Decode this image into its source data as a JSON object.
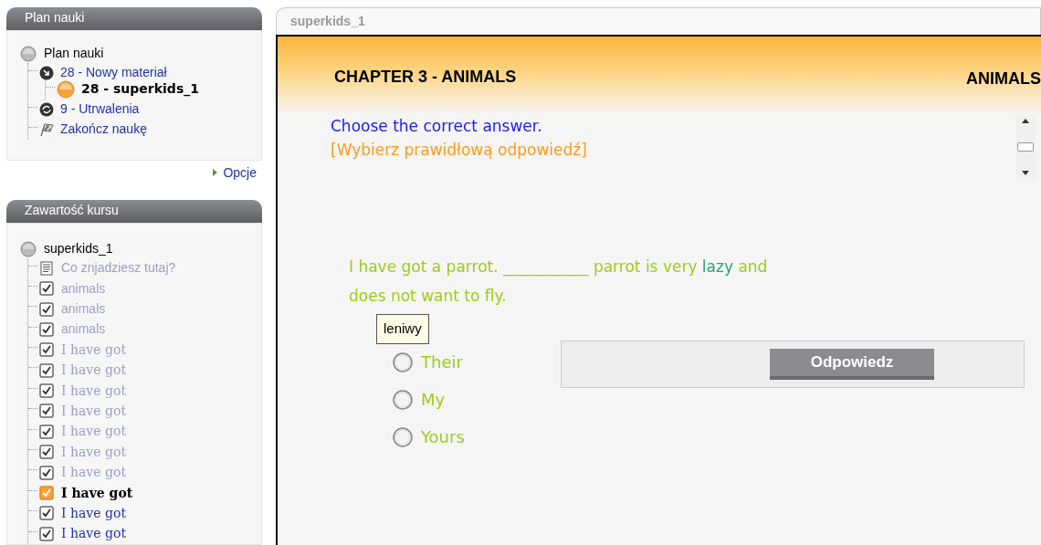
{
  "plan_panel": {
    "title": "Plan nauki",
    "root": {
      "label": "Plan nauki",
      "children": [
        {
          "kind": "arrow",
          "label": "28 - Nowy materiał",
          "selected": false,
          "children": [
            {
              "kind": "current",
              "label": "28 - superkids_1",
              "selected": true
            }
          ]
        },
        {
          "kind": "repeat",
          "label": "9 - Utrwalenia",
          "selected": false
        },
        {
          "kind": "finish",
          "label": "Zakończ naukę",
          "selected": false
        }
      ]
    },
    "options_link": "Opcje"
  },
  "course_panel": {
    "title": "Zawartość kursu",
    "root": "superkids_1",
    "items": [
      {
        "kind": "page",
        "label": "Co znjadziesz tutaj?",
        "visited": true,
        "selected": false
      },
      {
        "kind": "check",
        "label": "animals",
        "visited": true,
        "selected": false
      },
      {
        "kind": "check",
        "label": "animals",
        "visited": true,
        "selected": false
      },
      {
        "kind": "check",
        "label": "animals",
        "visited": true,
        "selected": false
      },
      {
        "kind": "check",
        "label": "I have got",
        "visited": true,
        "selected": false
      },
      {
        "kind": "check",
        "label": "I have got",
        "visited": true,
        "selected": false
      },
      {
        "kind": "check",
        "label": "I have got",
        "visited": true,
        "selected": false
      },
      {
        "kind": "check",
        "label": "I have got",
        "visited": true,
        "selected": false
      },
      {
        "kind": "check",
        "label": "I have got",
        "visited": true,
        "selected": false
      },
      {
        "kind": "check",
        "label": "I have got",
        "visited": true,
        "selected": false
      },
      {
        "kind": "check",
        "label": "I have got",
        "visited": true,
        "selected": false
      },
      {
        "kind": "check",
        "label": "I have got",
        "visited": false,
        "selected": true
      },
      {
        "kind": "check",
        "label": "I have got",
        "visited": false,
        "selected": false
      },
      {
        "kind": "check",
        "label": "I have got",
        "visited": false,
        "selected": false
      }
    ]
  },
  "lesson": {
    "tab": "superkids_1",
    "chapter": "CHAPTER 3 - ANIMALS",
    "chapter_right": "ANIMALS",
    "instruction": "Choose the correct answer.",
    "instruction_translation": "[Wybierz prawidłową odpowiedź]",
    "sentence": [
      {
        "text": "I have got a parrot. ___________ parrot is very ",
        "hovered": false
      },
      {
        "text": "lazy",
        "hovered": true
      },
      {
        "text": " and does not want to fly.",
        "hovered": false
      }
    ],
    "tooltip": "leniwy",
    "options": [
      {
        "label": "Their",
        "selected": false
      },
      {
        "label": "My",
        "selected": false
      },
      {
        "label": "Yours",
        "selected": false
      }
    ],
    "answer_button": "Odpowiedz"
  }
}
